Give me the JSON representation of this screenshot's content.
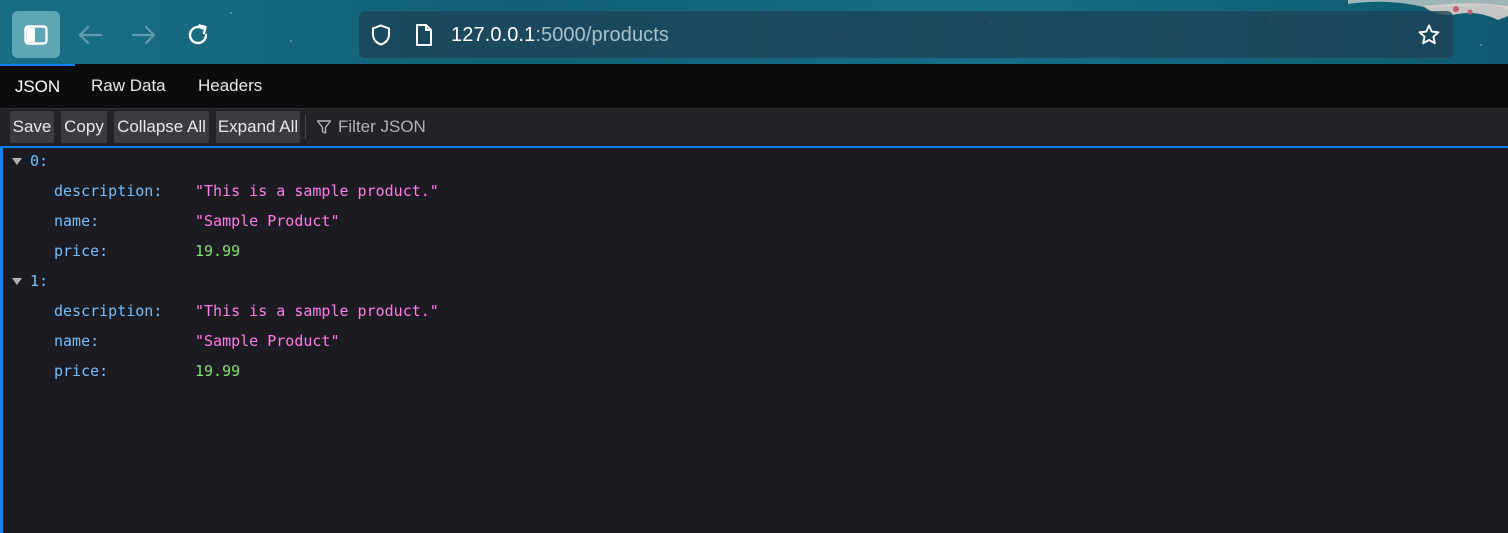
{
  "browser": {
    "url_host": "127.0.0.1",
    "url_path": ":5000/products",
    "icons": {
      "sidebar": "sidebar-icon",
      "back": "arrow-left-icon",
      "forward": "arrow-right-icon",
      "reload": "reload-icon",
      "shield": "shield-icon",
      "page": "page-icon",
      "bookmark": "star-icon"
    }
  },
  "viewer_tabs": [
    {
      "label": "JSON",
      "active": true
    },
    {
      "label": "Raw Data",
      "active": false
    },
    {
      "label": "Headers",
      "active": false
    }
  ],
  "viewer_toolbar": {
    "save_label": "Save",
    "copy_label": "Copy",
    "collapse_label": "Collapse All",
    "expand_label": "Expand All",
    "filter_placeholder": "Filter JSON"
  },
  "json": [
    {
      "index_label": "0:",
      "fields": [
        {
          "key": "description:",
          "value": "\"This is a sample product.\"",
          "type": "string"
        },
        {
          "key": "name:",
          "value": "\"Sample Product\"",
          "type": "string"
        },
        {
          "key": "price:",
          "value": "19.99",
          "type": "number"
        }
      ]
    },
    {
      "index_label": "1:",
      "fields": [
        {
          "key": "description:",
          "value": "\"This is a sample product.\"",
          "type": "string"
        },
        {
          "key": "name:",
          "value": "\"Sample Product\"",
          "type": "string"
        },
        {
          "key": "price:",
          "value": "19.99",
          "type": "number"
        }
      ]
    }
  ],
  "colors": {
    "accent": "#0a84ff",
    "key": "#75bfff",
    "string": "#ff7de9",
    "number": "#86de74"
  }
}
